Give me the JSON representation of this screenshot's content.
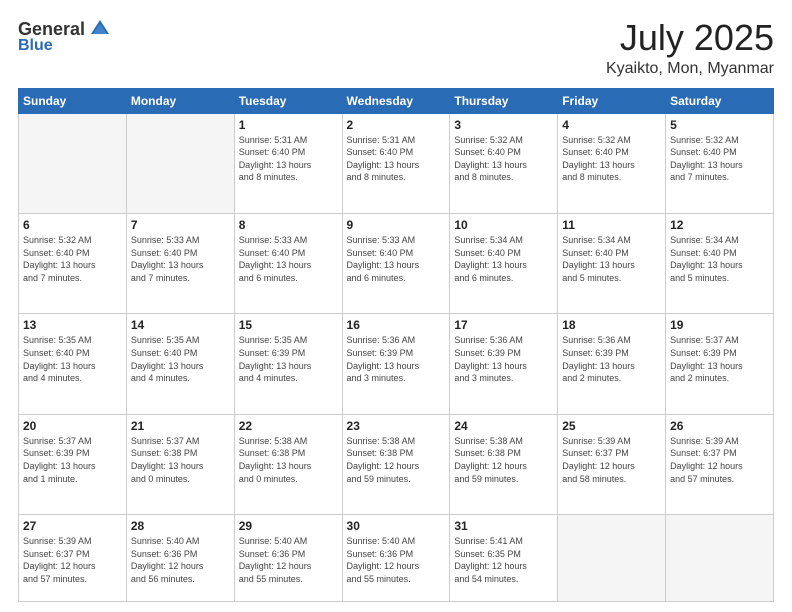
{
  "logo": {
    "general": "General",
    "blue": "Blue",
    "icon": "▶"
  },
  "title": {
    "month_year": "July 2025",
    "location": "Kyaikto, Mon, Myanmar"
  },
  "weekdays": [
    "Sunday",
    "Monday",
    "Tuesday",
    "Wednesday",
    "Thursday",
    "Friday",
    "Saturday"
  ],
  "weeks": [
    [
      {
        "day": "",
        "info": ""
      },
      {
        "day": "",
        "info": ""
      },
      {
        "day": "1",
        "info": "Sunrise: 5:31 AM\nSunset: 6:40 PM\nDaylight: 13 hours\nand 8 minutes."
      },
      {
        "day": "2",
        "info": "Sunrise: 5:31 AM\nSunset: 6:40 PM\nDaylight: 13 hours\nand 8 minutes."
      },
      {
        "day": "3",
        "info": "Sunrise: 5:32 AM\nSunset: 6:40 PM\nDaylight: 13 hours\nand 8 minutes."
      },
      {
        "day": "4",
        "info": "Sunrise: 5:32 AM\nSunset: 6:40 PM\nDaylight: 13 hours\nand 8 minutes."
      },
      {
        "day": "5",
        "info": "Sunrise: 5:32 AM\nSunset: 6:40 PM\nDaylight: 13 hours\nand 7 minutes."
      }
    ],
    [
      {
        "day": "6",
        "info": "Sunrise: 5:32 AM\nSunset: 6:40 PM\nDaylight: 13 hours\nand 7 minutes."
      },
      {
        "day": "7",
        "info": "Sunrise: 5:33 AM\nSunset: 6:40 PM\nDaylight: 13 hours\nand 7 minutes."
      },
      {
        "day": "8",
        "info": "Sunrise: 5:33 AM\nSunset: 6:40 PM\nDaylight: 13 hours\nand 6 minutes."
      },
      {
        "day": "9",
        "info": "Sunrise: 5:33 AM\nSunset: 6:40 PM\nDaylight: 13 hours\nand 6 minutes."
      },
      {
        "day": "10",
        "info": "Sunrise: 5:34 AM\nSunset: 6:40 PM\nDaylight: 13 hours\nand 6 minutes."
      },
      {
        "day": "11",
        "info": "Sunrise: 5:34 AM\nSunset: 6:40 PM\nDaylight: 13 hours\nand 5 minutes."
      },
      {
        "day": "12",
        "info": "Sunrise: 5:34 AM\nSunset: 6:40 PM\nDaylight: 13 hours\nand 5 minutes."
      }
    ],
    [
      {
        "day": "13",
        "info": "Sunrise: 5:35 AM\nSunset: 6:40 PM\nDaylight: 13 hours\nand 4 minutes."
      },
      {
        "day": "14",
        "info": "Sunrise: 5:35 AM\nSunset: 6:40 PM\nDaylight: 13 hours\nand 4 minutes."
      },
      {
        "day": "15",
        "info": "Sunrise: 5:35 AM\nSunset: 6:39 PM\nDaylight: 13 hours\nand 4 minutes."
      },
      {
        "day": "16",
        "info": "Sunrise: 5:36 AM\nSunset: 6:39 PM\nDaylight: 13 hours\nand 3 minutes."
      },
      {
        "day": "17",
        "info": "Sunrise: 5:36 AM\nSunset: 6:39 PM\nDaylight: 13 hours\nand 3 minutes."
      },
      {
        "day": "18",
        "info": "Sunrise: 5:36 AM\nSunset: 6:39 PM\nDaylight: 13 hours\nand 2 minutes."
      },
      {
        "day": "19",
        "info": "Sunrise: 5:37 AM\nSunset: 6:39 PM\nDaylight: 13 hours\nand 2 minutes."
      }
    ],
    [
      {
        "day": "20",
        "info": "Sunrise: 5:37 AM\nSunset: 6:39 PM\nDaylight: 13 hours\nand 1 minute."
      },
      {
        "day": "21",
        "info": "Sunrise: 5:37 AM\nSunset: 6:38 PM\nDaylight: 13 hours\nand 0 minutes."
      },
      {
        "day": "22",
        "info": "Sunrise: 5:38 AM\nSunset: 6:38 PM\nDaylight: 13 hours\nand 0 minutes."
      },
      {
        "day": "23",
        "info": "Sunrise: 5:38 AM\nSunset: 6:38 PM\nDaylight: 12 hours\nand 59 minutes."
      },
      {
        "day": "24",
        "info": "Sunrise: 5:38 AM\nSunset: 6:38 PM\nDaylight: 12 hours\nand 59 minutes."
      },
      {
        "day": "25",
        "info": "Sunrise: 5:39 AM\nSunset: 6:37 PM\nDaylight: 12 hours\nand 58 minutes."
      },
      {
        "day": "26",
        "info": "Sunrise: 5:39 AM\nSunset: 6:37 PM\nDaylight: 12 hours\nand 57 minutes."
      }
    ],
    [
      {
        "day": "27",
        "info": "Sunrise: 5:39 AM\nSunset: 6:37 PM\nDaylight: 12 hours\nand 57 minutes."
      },
      {
        "day": "28",
        "info": "Sunrise: 5:40 AM\nSunset: 6:36 PM\nDaylight: 12 hours\nand 56 minutes."
      },
      {
        "day": "29",
        "info": "Sunrise: 5:40 AM\nSunset: 6:36 PM\nDaylight: 12 hours\nand 55 minutes."
      },
      {
        "day": "30",
        "info": "Sunrise: 5:40 AM\nSunset: 6:36 PM\nDaylight: 12 hours\nand 55 minutes."
      },
      {
        "day": "31",
        "info": "Sunrise: 5:41 AM\nSunset: 6:35 PM\nDaylight: 12 hours\nand 54 minutes."
      },
      {
        "day": "",
        "info": ""
      },
      {
        "day": "",
        "info": ""
      }
    ]
  ]
}
